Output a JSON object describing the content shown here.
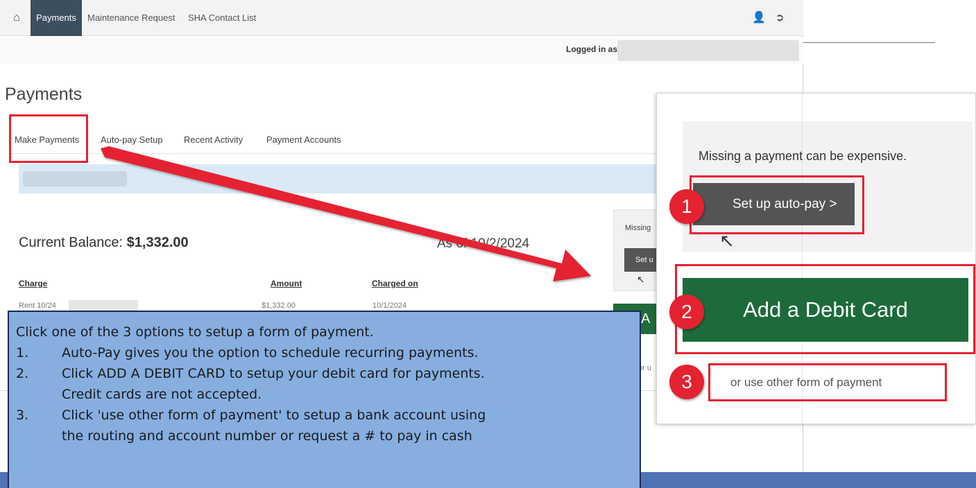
{
  "navbar": {
    "home_icon": "home-icon",
    "items": [
      {
        "label": "Payments",
        "active": true
      },
      {
        "label": "Maintenance Request",
        "active": false
      },
      {
        "label": "SHA Contact List",
        "active": false
      }
    ],
    "user_icon": "user-icon",
    "logout_icon": "sign-out-icon"
  },
  "logged_in": {
    "label": "Logged in as:"
  },
  "page": {
    "title": "Payments"
  },
  "tabs": [
    {
      "label": "Make Payments",
      "active": true
    },
    {
      "label": "Auto-pay Setup",
      "active": false
    },
    {
      "label": "Recent Activity",
      "active": false
    },
    {
      "label": "Payment Accounts",
      "active": false
    }
  ],
  "balance": {
    "label": "Current Balance: ",
    "amount": "$1,332.00",
    "as_of": "As of 10/2/2024"
  },
  "table": {
    "headers": [
      "Charge",
      "Amount",
      "Charged on"
    ],
    "rows": [
      {
        "charge": "Rent 10/24",
        "amount": "$1,332.00",
        "charged_on": "10/1/2024"
      }
    ]
  },
  "mini_panel": {
    "missing": "Missing",
    "button": "Set u",
    "green": "A",
    "or": "or u"
  },
  "zoom_panel": {
    "missing_text": "Missing a payment can be expensive.",
    "autopay_button": "Set up auto-pay >",
    "debit_button": "Add a Debit Card",
    "other_link": "or use other form of payment"
  },
  "markers": [
    "1",
    "2",
    "3"
  ],
  "callout": {
    "intro": "Click one of the 3 options to setup a form of payment.",
    "steps": [
      {
        "num": "1.",
        "text": "Auto-Pay gives you the option to schedule recurring payments."
      },
      {
        "num": "2.",
        "text": "Click ADD A DEBIT CARD to setup your debit card for payments.",
        "extra": "Credit cards are not accepted."
      },
      {
        "num": "3.",
        "text": "Click 'use other form of payment' to setup a bank account using",
        "extra": "the routing and account number or request a # to pay in cash"
      }
    ]
  },
  "colors": {
    "accent_red": "#e52230",
    "nav_active": "#3d4f5f",
    "debit_green": "#1d6b3b",
    "callout_blue": "#86afe0"
  }
}
